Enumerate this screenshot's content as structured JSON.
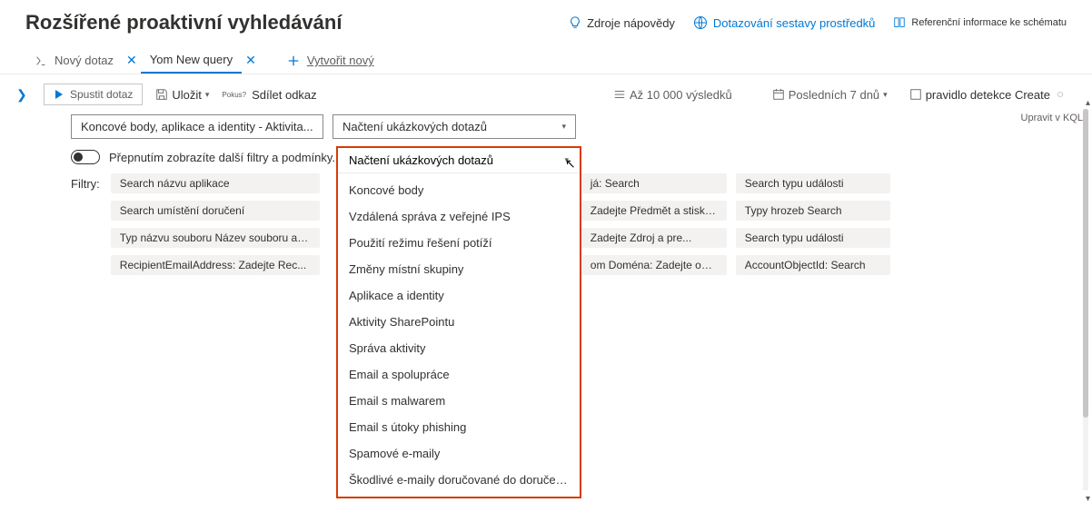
{
  "header": {
    "title": "Rozšířené proaktivní vyhledávání",
    "help_link": "Zdroje nápovědy",
    "resources_link": "Dotazování sestavy prostředků",
    "schema_link": "Referenční informace ke schématu"
  },
  "tabs": {
    "tab1": "Nový dotaz",
    "tab2": "Yom New query",
    "create": "Vytvořit nový"
  },
  "toolbar": {
    "run": "Spustit dotaz",
    "save": "Uložit",
    "share": "Sdílet odkaz",
    "results": "Až 10 000 výsledků",
    "timerange": "Posledních 7 dnů",
    "detection": "pravidlo detekce Create",
    "kql": "Upravit v KQL"
  },
  "content": {
    "main_input": "Koncové body, aplikace a identity - Aktivita...",
    "dropdown_label": "Načtení ukázkových dotazů",
    "toggle_label": "Přepnutím zobrazíte další filtry a podmínky.",
    "filters_label": "Filtry:"
  },
  "chips": {
    "r1c1": "Search názvu aplikace",
    "r1c2": "já: Search",
    "r1c3": "Search typu události",
    "r2c1": "Search umístění doručení",
    "r2c2": "Zadejte Předmět a stiskněte ...",
    "r2c3": "Typy hrozeb Search",
    "r3c1": "Typ názvu souboru Název souboru a pr...",
    "r3c2": "Zadejte Zdroj a pre...",
    "r3c3": "Search typu události",
    "r4c1": "RecipientEmailAddress: Zadejte Rec...",
    "r4c2": "om Doména: Zadejte odesílatele...",
    "r4c3": "AccountObjectId: Search"
  },
  "dropdown": {
    "items": [
      "Koncové body",
      "Vzdálená správa z veřejné IPS",
      "Použití režimu řešení potíží",
      "Změny místní skupiny",
      "Aplikace a identity",
      "Aktivity SharePointu",
      "Správa aktivity",
      "Email a spolupráce",
      "Email s malwarem",
      "Email s útoky phishing",
      "Spamové e-maily",
      "Škodlivé e-maily doručované do doručené pošty nebo nevyžádané pošty"
    ]
  }
}
